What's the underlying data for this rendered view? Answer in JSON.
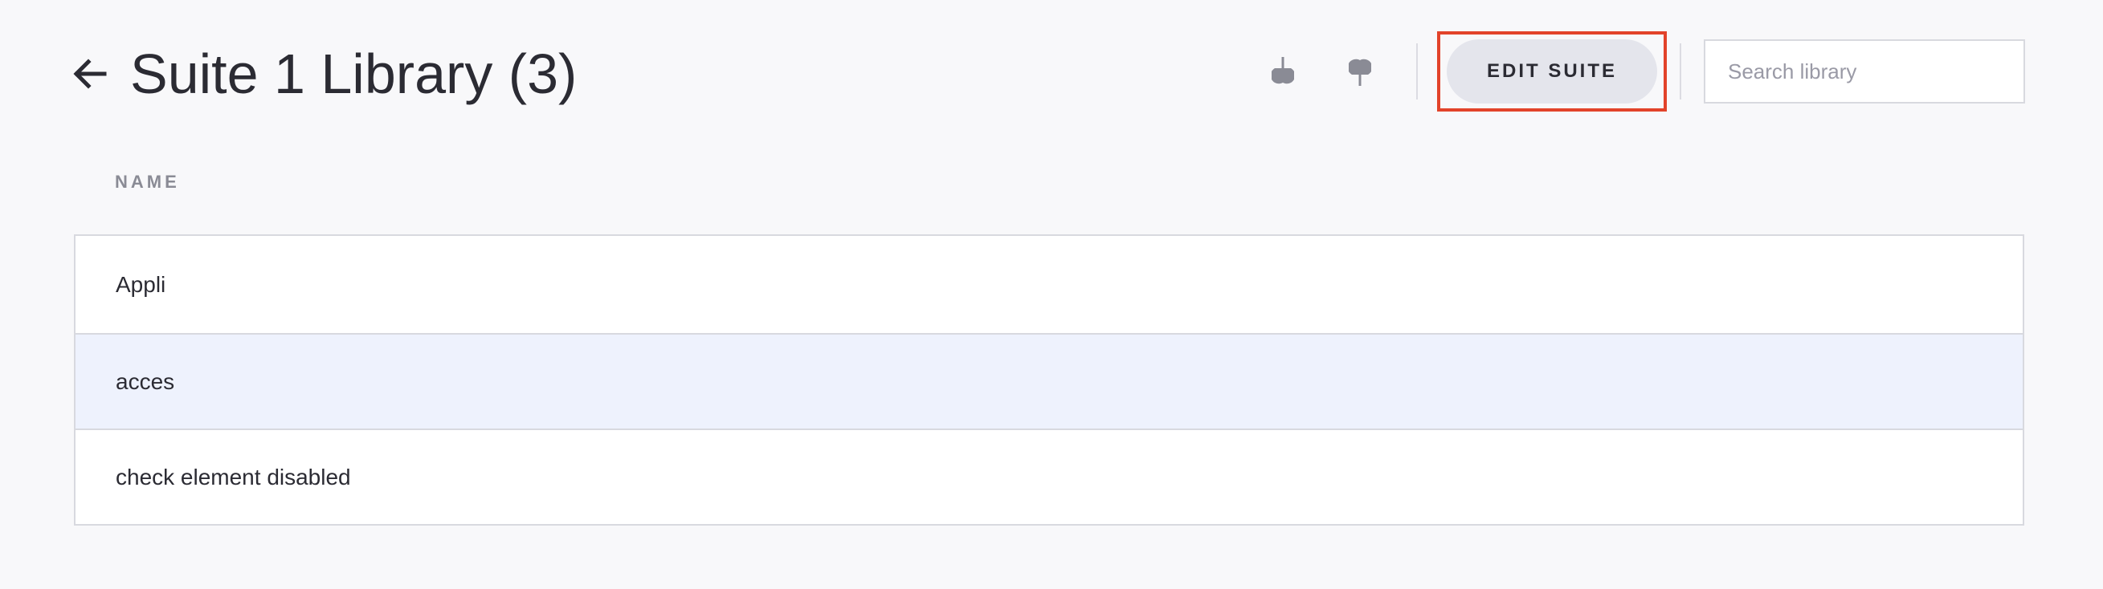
{
  "header": {
    "title": "Suite 1 Library (3)",
    "back_icon": "arrow-left-icon",
    "download_icon": "download-icon",
    "upload_icon": "upload-icon",
    "edit_label": "EDIT SUITE",
    "search": {
      "placeholder": "Search library",
      "value": ""
    }
  },
  "table": {
    "columns": [
      "NAME"
    ],
    "rows": [
      {
        "name": "Appli",
        "selected": false
      },
      {
        "name": "acces",
        "selected": true
      },
      {
        "name": "check element disabled",
        "selected": false
      }
    ]
  },
  "colors": {
    "accent_highlight": "#e2432a",
    "selected_row": "#eef2fd",
    "button_bg": "#e4e5ec"
  }
}
